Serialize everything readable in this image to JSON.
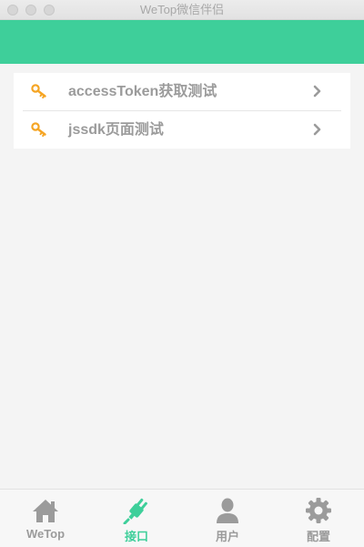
{
  "window": {
    "title": "WeTop微信伴侣"
  },
  "colors": {
    "accent": "#3ecf9a",
    "icon_orange": "#f5a524",
    "inactive": "#9b9b9b",
    "background": "#f4f4f4"
  },
  "list": {
    "items": [
      {
        "icon": "key-icon",
        "label": "accessToken获取测试"
      },
      {
        "icon": "key-icon",
        "label": "jssdk页面测试"
      }
    ]
  },
  "tabbar": {
    "tabs": [
      {
        "icon": "home-icon",
        "label": "WeTop",
        "active": false
      },
      {
        "icon": "plug-icon",
        "label": "接口",
        "active": true
      },
      {
        "icon": "user-icon",
        "label": "用户",
        "active": false
      },
      {
        "icon": "gear-icon",
        "label": "配置",
        "active": false
      }
    ]
  }
}
